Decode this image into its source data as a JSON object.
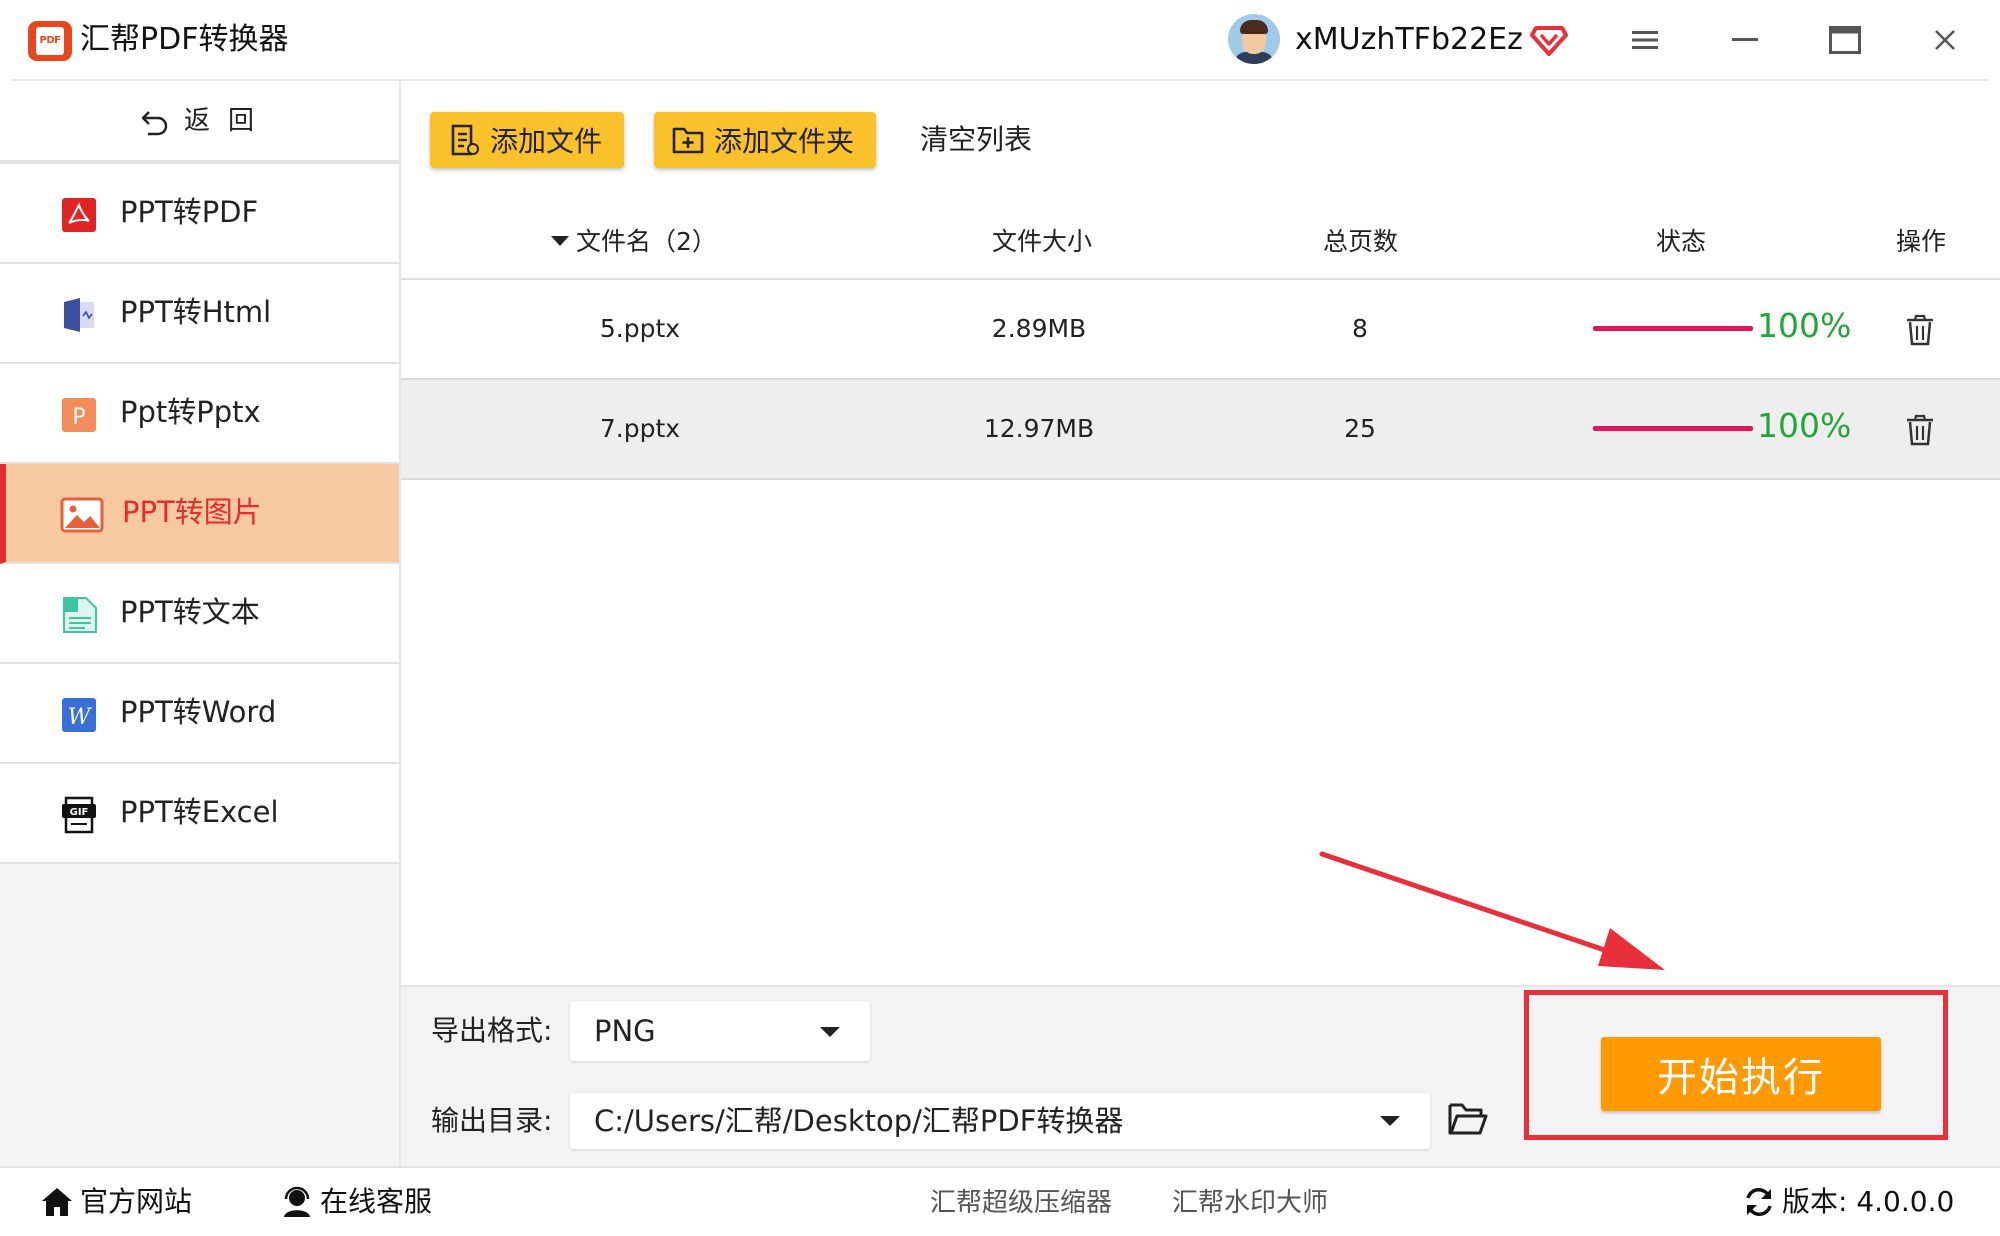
{
  "app": {
    "title": "汇帮PDF转换器",
    "logo_text": "PDF"
  },
  "user": {
    "name": "xMUzhTFb22Ez"
  },
  "window_controls": [
    "menu-icon",
    "minimize-icon",
    "maximize-icon",
    "close-icon"
  ],
  "sidebar": {
    "back_label": "返回",
    "items": [
      {
        "label": "PPT转PDF",
        "icon": "pdf-icon"
      },
      {
        "label": "PPT转Html",
        "icon": "html-icon"
      },
      {
        "label": "Ppt转Pptx",
        "icon": "pptx-icon"
      },
      {
        "label": "PPT转图片",
        "icon": "image-icon",
        "active": true
      },
      {
        "label": "PPT转文本",
        "icon": "text-icon"
      },
      {
        "label": "PPT转Word",
        "icon": "word-icon"
      },
      {
        "label": "PPT转Excel",
        "icon": "gif-icon"
      }
    ]
  },
  "toolbar": {
    "add_file": "添加文件",
    "add_folder": "添加文件夹",
    "clear_list": "清空列表"
  },
  "table": {
    "columns": {
      "name": "文件名（2）",
      "size": "文件大小",
      "pages": "总页数",
      "status": "状态",
      "action": "操作"
    },
    "rows": [
      {
        "name": "5.pptx",
        "size": "2.89MB",
        "pages": "8",
        "progress": 1.0,
        "progress_label": "100%"
      },
      {
        "name": "7.pptx",
        "size": "12.97MB",
        "pages": "25",
        "progress": 1.0,
        "progress_label": "100%"
      }
    ]
  },
  "settings": {
    "format_label": "导出格式:",
    "format_value": "PNG",
    "dir_label": "输出目录:",
    "dir_value": "C:/Users/汇帮/Desktop/汇帮PDF转换器",
    "start_label": "开始执行"
  },
  "footer": {
    "website": "官方网站",
    "support": "在线客服",
    "link1": "汇帮超级压缩器",
    "link2": "汇帮水印大师",
    "version": "版本: 4.0.0.0"
  },
  "colors": {
    "accent_yellow": "#f9c12a",
    "start_orange": "#ff9a05",
    "active_bg": "#f6c9a1",
    "active_red": "#e52b2b",
    "progress_pink": "#e0155c",
    "progress_green": "#22a638",
    "annotation_red": "#e8303a"
  }
}
